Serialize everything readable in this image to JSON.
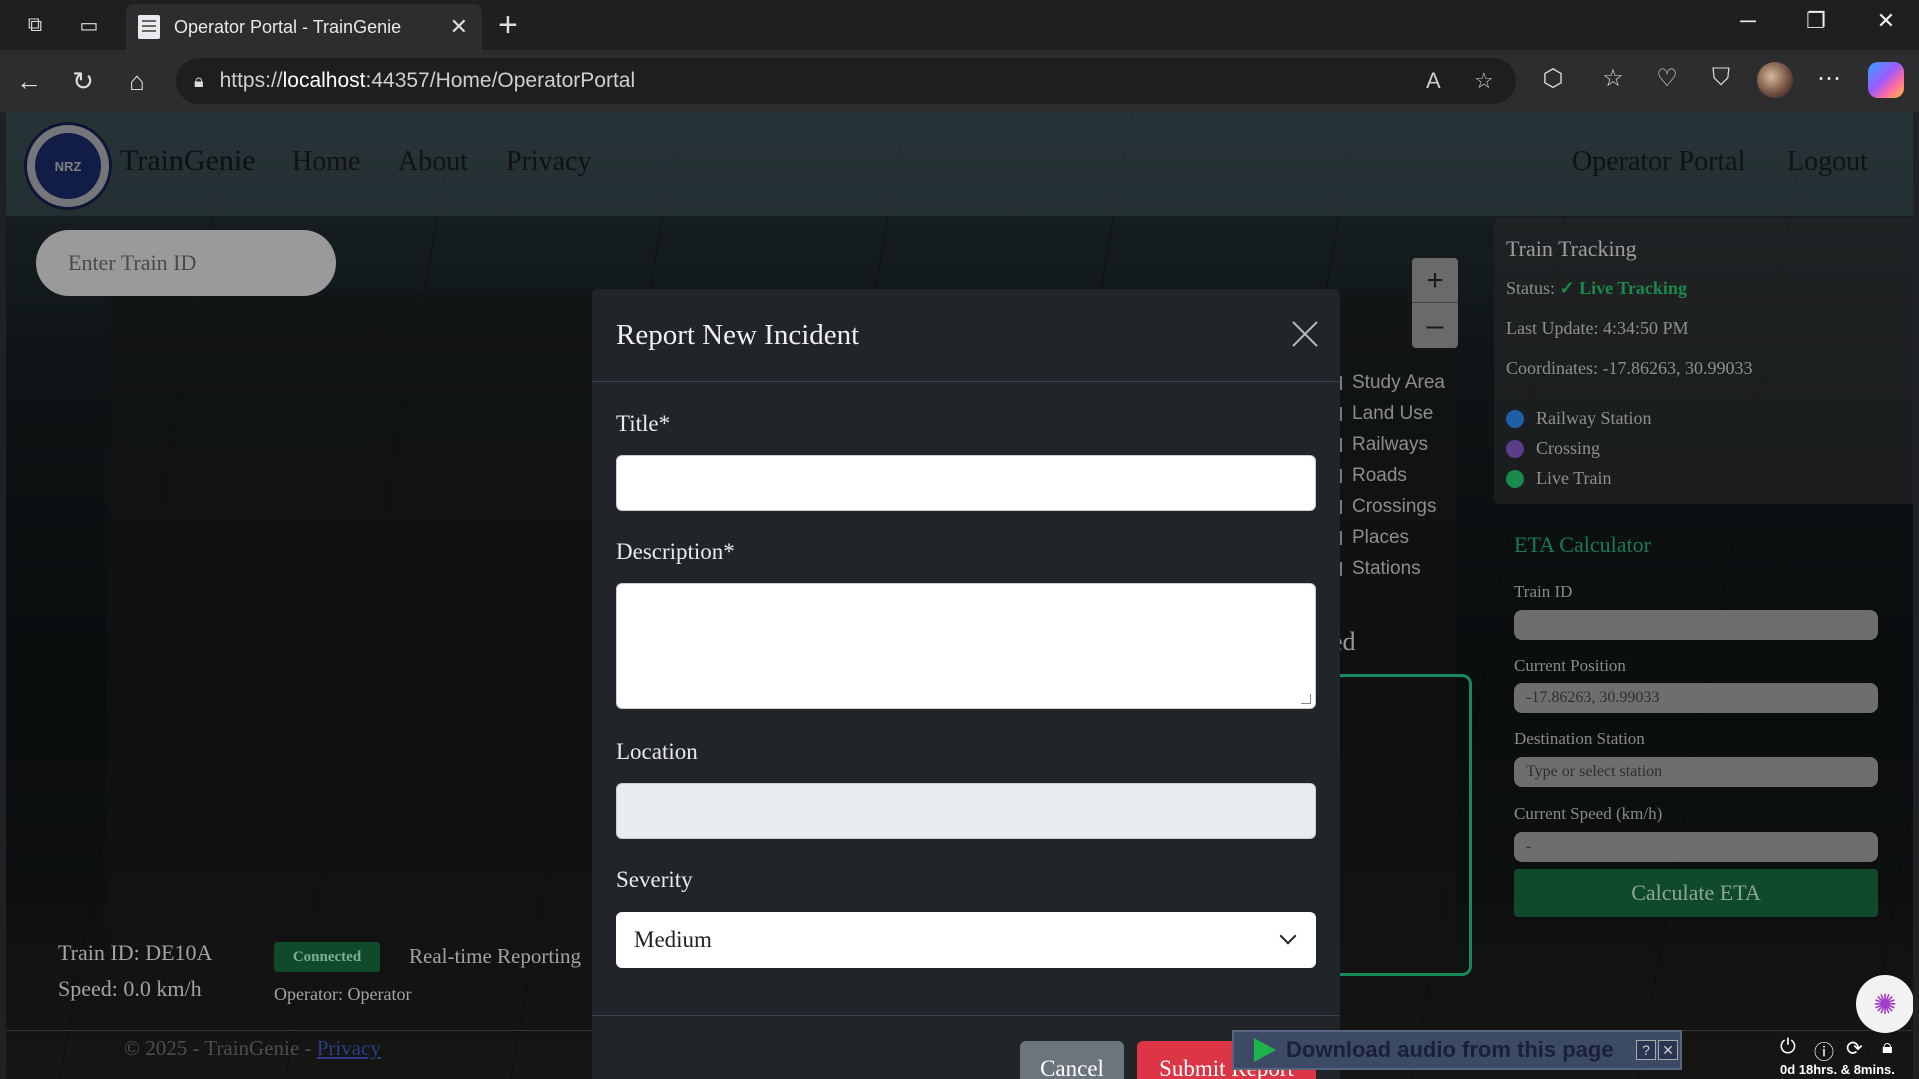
{
  "browser": {
    "tab_title": "Operator Portal - TrainGenie",
    "url_prefix": "https://",
    "url_host": "localhost",
    "url_rest": ":44357/Home/OperatorPortal"
  },
  "navbar": {
    "brand": "TrainGenie",
    "logo_text": "NRZ",
    "links": [
      "Home",
      "About",
      "Privacy"
    ],
    "right_links": [
      "Operator Portal",
      "Logout"
    ]
  },
  "map": {
    "train_input_placeholder": "Enter Train ID",
    "zoom_in": "+",
    "zoom_out": "–",
    "layers": [
      "Study Area",
      "Land Use",
      "Railways",
      "Roads",
      "Crossings",
      "Places",
      "Stations"
    ],
    "partial_heading": "ed"
  },
  "tracking": {
    "title": "Train Tracking",
    "status_label": "Status:",
    "status_value": "✓ Live Tracking",
    "last_update": "Last Update: 4:34:50 PM",
    "coordinates": "Coordinates: -17.86263, 30.99033",
    "legend": [
      {
        "label": "Railway Station",
        "color": "#1f5fa8"
      },
      {
        "label": "Crossing",
        "color": "#5b3d8a"
      },
      {
        "label": "Live Train",
        "color": "#1a8a4a"
      }
    ]
  },
  "eta": {
    "title": "ETA Calculator",
    "train_id_label": "Train ID",
    "train_id_value": "",
    "current_position_label": "Current Position",
    "current_position_value": "-17.86263, 30.99033",
    "destination_label": "Destination Station",
    "destination_placeholder": "Type or select station",
    "speed_label": "Current Speed (km/h)",
    "speed_value": "-",
    "button": "Calculate ETA"
  },
  "bottom": {
    "train_id": "Train ID: DE10A",
    "speed": "Speed: 0.0 km/h",
    "badge": "Connected",
    "realtime": "Real-time Reporting",
    "operator": "Operator: Operator"
  },
  "footer": {
    "copyright": "© 2025 - TrainGenie - ",
    "privacy_link": "Privacy"
  },
  "extension": {
    "download_text": "Download audio from this page",
    "help": "?",
    "close": "✕"
  },
  "system": {
    "timer": "0d 18hrs. & 8mins."
  },
  "modal": {
    "title": "Report New Incident",
    "title_label": "Title*",
    "title_value": "",
    "description_label": "Description*",
    "description_value": "",
    "location_label": "Location",
    "location_value": "",
    "severity_label": "Severity",
    "severity_value": "Medium",
    "cancel": "Cancel",
    "submit": "Submit Report"
  }
}
